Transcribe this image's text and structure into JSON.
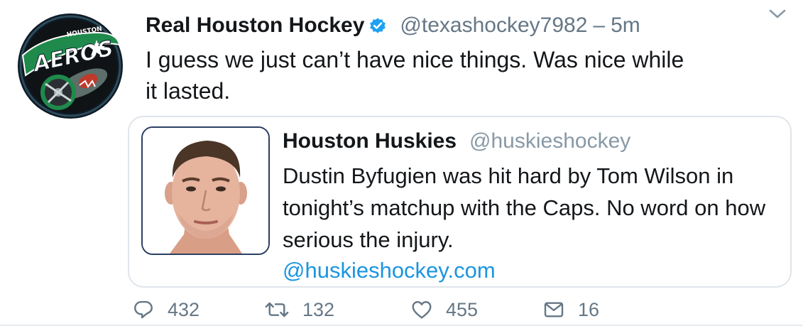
{
  "tweet": {
    "display_name": "Real Houston Hockey",
    "handle": "@texashockey7982",
    "separator": "–",
    "time": "5m",
    "text": "I guess we just can’t have nice things. Was nice while it lasted.",
    "avatar_wordmark": "AEROS",
    "avatar_topword": "HOUSTON"
  },
  "quote": {
    "display_name": "Houston Huskies",
    "handle": "@huskieshockey",
    "text": "Dustin Byfugien was hit hard by Tom Wilson in tonight’s matchup with the Caps. No word on how serious the injury.",
    "link": "@huskieshockey.com"
  },
  "actions": {
    "replies": "432",
    "retweets": "132",
    "likes": "455",
    "messages": "16"
  },
  "colors": {
    "verified": "#1da1f2",
    "link": "#1b95e0",
    "secondary_text": "#657786",
    "avatar_green": "#1f8a4c"
  },
  "icons": [
    "verified-badge-icon",
    "chevron-down-icon",
    "reply-icon",
    "retweet-icon",
    "like-icon",
    "direct-message-icon"
  ]
}
